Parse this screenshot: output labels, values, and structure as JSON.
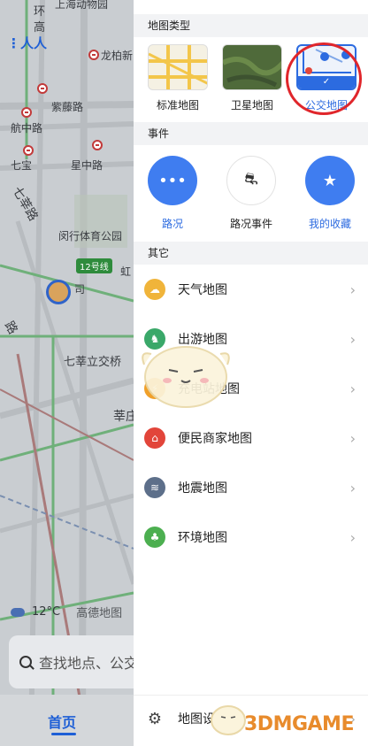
{
  "map": {
    "labels": {
      "road_top": "上海动物园",
      "huan": "环",
      "gao": "高",
      "longbai": "龙柏新",
      "zitenglu": "紫藤路",
      "hangzhonglu": "航中路",
      "qibao": "七宝",
      "xingzhonglu": "星中路",
      "qixinlu": "七莘路",
      "minhang_gym": "闵行体育公园",
      "hong": "虹",
      "si": "司",
      "lu": "路",
      "qixin_junction": "七莘立交桥",
      "xing": "莘庄",
      "line12": "12号线"
    },
    "weather": {
      "temp": "12°C",
      "brand": "高德地图"
    },
    "search_placeholder": "查找地点、公交",
    "home_tab": "首页"
  },
  "panel": {
    "map_type": {
      "header": "地图类型",
      "options": [
        {
          "label": "标准地图",
          "active": false
        },
        {
          "label": "卫星地图",
          "active": false
        },
        {
          "label": "公交地图",
          "active": true
        }
      ]
    },
    "events": {
      "header": "事件",
      "items": [
        {
          "label": "路况",
          "glyph": "•••"
        },
        {
          "label": "路况事件",
          "glyph": "⛐"
        },
        {
          "label": "我的收藏",
          "glyph": "★"
        }
      ]
    },
    "other": {
      "header": "其它",
      "items": [
        {
          "label": "天气地图",
          "color": "#f0b43a",
          "glyph": "☁"
        },
        {
          "label": "出游地图",
          "color": "#3aa869",
          "glyph": "♞"
        },
        {
          "label": "充电站地图",
          "color": "#f0a02a",
          "glyph": "⚡"
        },
        {
          "label": "便民商家地图",
          "color": "#e2453a",
          "glyph": "⌂"
        },
        {
          "label": "地震地图",
          "color": "#5d6f8a",
          "glyph": "≋"
        },
        {
          "label": "环境地图",
          "color": "#4caf50",
          "glyph": "♣"
        }
      ]
    },
    "settings": {
      "label": "地图设置",
      "chevron": "›"
    }
  },
  "watermark": "3DMGAME",
  "colors": {
    "accent": "#2c6be0",
    "highlight_circle": "#e0262b",
    "panel_bg": "#ffffff"
  }
}
